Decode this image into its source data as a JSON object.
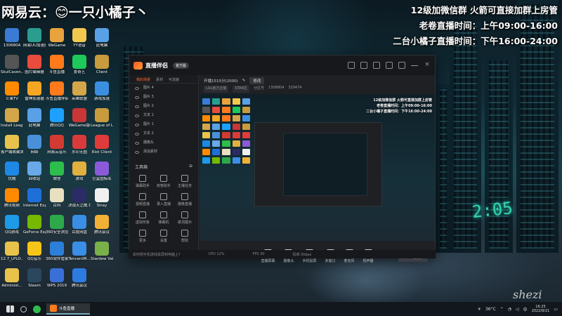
{
  "overlay": {
    "title": "网易云：😊一只小橘子丶",
    "lines": [
      "12级加微信群 火箭可直接加群上房管",
      "老卷直播时间：上午09:00-16:00",
      "二台小橘子直播时间：下午16:00-24:00"
    ]
  },
  "desktop_icons": [
    {
      "label": "130680A",
      "color": "#3a7bd5"
    },
    {
      "label": "网易UU加速器",
      "color": "#2a9d8f"
    },
    {
      "label": "WeGame",
      "color": "#e8a33c"
    },
    {
      "label": "YY语音",
      "color": "#f2c94c"
    },
    {
      "label": "此电脑",
      "color": "#5aa0e6"
    },
    {
      "label": "SkulCaven...",
      "color": "#555"
    },
    {
      "label": "图片编辑器",
      "color": "#e74c3c"
    },
    {
      "label": "斗鱼直播",
      "color": "#ff7a1a"
    },
    {
      "label": "爱奇艺",
      "color": "#1ec85a"
    },
    {
      "label": "Client",
      "color": "#c89b3c"
    },
    {
      "label": "芒果TV",
      "color": "#ff8a00"
    },
    {
      "label": "雷神加速器",
      "color": "#f5a623"
    },
    {
      "label": "斗鱼直播伴侣",
      "color": "#ff7a1a"
    },
    {
      "label": "英雄联盟",
      "color": "#d4a64a"
    },
    {
      "label": "游戏加速",
      "color": "#3b8fe0"
    },
    {
      "label": "Install League...",
      "color": "#d4a64a"
    },
    {
      "label": "此电脑",
      "color": "#5aa0e6"
    },
    {
      "label": "腾讯QQ",
      "color": "#1ea0ff"
    },
    {
      "label": "WeGame版",
      "color": "#c93636"
    },
    {
      "label": "League of Legends...",
      "color": "#c89b3c"
    },
    {
      "label": "客户端收藏夹(1)",
      "color": "#e8c24a"
    },
    {
      "label": "网络",
      "color": "#4a90d9"
    },
    {
      "label": "网易云音乐",
      "color": "#d33a31"
    },
    {
      "label": "水印无图",
      "color": "#d93b3b"
    },
    {
      "label": "Riot Client",
      "color": "#e03b3b"
    },
    {
      "label": "优酷",
      "color": "#1e88e5"
    },
    {
      "label": "回收站",
      "color": "#6aa9e8"
    },
    {
      "label": "微信",
      "color": "#2dbd4b"
    },
    {
      "label": "游戏",
      "color": "#e0b040"
    },
    {
      "label": "巨鲨图标库",
      "color": "#8a5ad8"
    },
    {
      "label": "腾讯视频",
      "color": "#ff8a00"
    },
    {
      "label": "Internet Explorer",
      "color": "#1e6fd8"
    },
    {
      "label": "百科",
      "color": "#e8e0c0"
    },
    {
      "label": "决战天之威 Dance of F...",
      "color": "#2b2b66"
    },
    {
      "label": "Stray",
      "color": "#f0f0f0"
    },
    {
      "label": "QQ游戏",
      "color": "#1e9be8"
    },
    {
      "label": "GeForce Experience",
      "color": "#76b900"
    },
    {
      "label": "360安全浏览器",
      "color": "#2ea84a"
    },
    {
      "label": "百度网盘",
      "color": "#3a8ee6"
    },
    {
      "label": "腾讯会议",
      "color": "#f2b134"
    },
    {
      "label": "12.7_LPLO...",
      "color": "#e8c24a"
    },
    {
      "label": "QQ音乐",
      "color": "#f5c518"
    },
    {
      "label": "360软件管家",
      "color": "#2b7fd9"
    },
    {
      "label": "TencentM...",
      "color": "#3a8ee6"
    },
    {
      "label": "Stardew Valley",
      "color": "#7ab04a"
    },
    {
      "label": "Administ...",
      "color": "#e8c24a"
    },
    {
      "label": "Steam",
      "color": "#2a475e"
    },
    {
      "label": "WPS 2019",
      "color": "#3a6fd8"
    },
    {
      "label": "腾讯会议",
      "color": "#2d7be0"
    }
  ],
  "app": {
    "name": "直播伴侣",
    "version": "官方版",
    "tabs": [
      "我的场景",
      "素材",
      "可选装"
    ],
    "scenes": [
      "图片 4",
      "图片 3",
      "图片 2",
      "文本 1",
      "图片 1",
      "文本 2",
      "摄像头",
      "添加素材"
    ],
    "tools_title": "工具箱",
    "tools": [
      "弹幕助手",
      "房管助手",
      "主播任务",
      "视频直播",
      "录入直播",
      "摄像直播",
      "虚拟形象",
      "弹幕机",
      "歌词展示",
      "更多",
      "设置",
      "帮助"
    ],
    "room_title": "开播1515分(2000)",
    "room_btn": "修改",
    "sub_tags": [
      "LOL官方正版",
      "STAR区",
      "分区号",
      "1308804",
      "329474"
    ],
    "preview_lines": [
      "12级加微信群 火箭可直接加群上房管",
      "老卷直播时间：上午09:00-16:00",
      "二台小橘子直播时间：下午16:00-24:00"
    ],
    "controls": [
      "直播屏幕",
      "摄像头",
      "手机投屏",
      "多窗口",
      "麦克风",
      "扬声器"
    ],
    "go_live": "开始直播",
    "status": [
      "CPU 12%",
      "FPS 30",
      "码率 0kbps",
      "丢帧 0",
      "内存"
    ],
    "tip": "如何把手机游戏投屏到电脑上?"
  },
  "taskbar": {
    "app_label": "斗鱼直播",
    "temperature": "36°C",
    "time": "16:25",
    "date": "2022/8/21",
    "lang": "中"
  },
  "scene_deco": {
    "clock": "2:05"
  },
  "signature": "shezi"
}
